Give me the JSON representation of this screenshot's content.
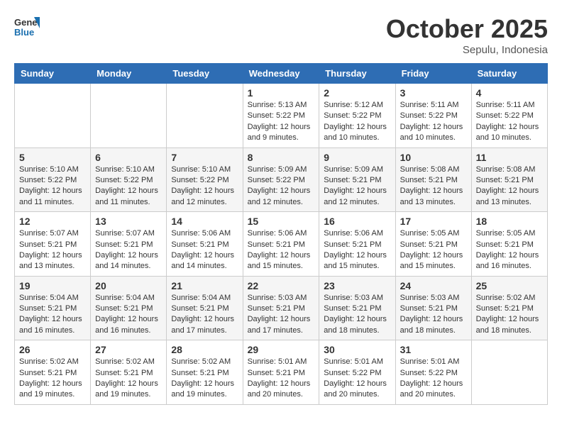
{
  "header": {
    "logo_line1": "General",
    "logo_line2": "Blue",
    "month": "October 2025",
    "location": "Sepulu, Indonesia"
  },
  "weekdays": [
    "Sunday",
    "Monday",
    "Tuesday",
    "Wednesday",
    "Thursday",
    "Friday",
    "Saturday"
  ],
  "weeks": [
    [
      {
        "day": "",
        "sunrise": "",
        "sunset": "",
        "daylight": ""
      },
      {
        "day": "",
        "sunrise": "",
        "sunset": "",
        "daylight": ""
      },
      {
        "day": "",
        "sunrise": "",
        "sunset": "",
        "daylight": ""
      },
      {
        "day": "1",
        "sunrise": "Sunrise: 5:13 AM",
        "sunset": "Sunset: 5:22 PM",
        "daylight": "Daylight: 12 hours and 9 minutes."
      },
      {
        "day": "2",
        "sunrise": "Sunrise: 5:12 AM",
        "sunset": "Sunset: 5:22 PM",
        "daylight": "Daylight: 12 hours and 10 minutes."
      },
      {
        "day": "3",
        "sunrise": "Sunrise: 5:11 AM",
        "sunset": "Sunset: 5:22 PM",
        "daylight": "Daylight: 12 hours and 10 minutes."
      },
      {
        "day": "4",
        "sunrise": "Sunrise: 5:11 AM",
        "sunset": "Sunset: 5:22 PM",
        "daylight": "Daylight: 12 hours and 10 minutes."
      }
    ],
    [
      {
        "day": "5",
        "sunrise": "Sunrise: 5:10 AM",
        "sunset": "Sunset: 5:22 PM",
        "daylight": "Daylight: 12 hours and 11 minutes."
      },
      {
        "day": "6",
        "sunrise": "Sunrise: 5:10 AM",
        "sunset": "Sunset: 5:22 PM",
        "daylight": "Daylight: 12 hours and 11 minutes."
      },
      {
        "day": "7",
        "sunrise": "Sunrise: 5:10 AM",
        "sunset": "Sunset: 5:22 PM",
        "daylight": "Daylight: 12 hours and 12 minutes."
      },
      {
        "day": "8",
        "sunrise": "Sunrise: 5:09 AM",
        "sunset": "Sunset: 5:22 PM",
        "daylight": "Daylight: 12 hours and 12 minutes."
      },
      {
        "day": "9",
        "sunrise": "Sunrise: 5:09 AM",
        "sunset": "Sunset: 5:21 PM",
        "daylight": "Daylight: 12 hours and 12 minutes."
      },
      {
        "day": "10",
        "sunrise": "Sunrise: 5:08 AM",
        "sunset": "Sunset: 5:21 PM",
        "daylight": "Daylight: 12 hours and 13 minutes."
      },
      {
        "day": "11",
        "sunrise": "Sunrise: 5:08 AM",
        "sunset": "Sunset: 5:21 PM",
        "daylight": "Daylight: 12 hours and 13 minutes."
      }
    ],
    [
      {
        "day": "12",
        "sunrise": "Sunrise: 5:07 AM",
        "sunset": "Sunset: 5:21 PM",
        "daylight": "Daylight: 12 hours and 13 minutes."
      },
      {
        "day": "13",
        "sunrise": "Sunrise: 5:07 AM",
        "sunset": "Sunset: 5:21 PM",
        "daylight": "Daylight: 12 hours and 14 minutes."
      },
      {
        "day": "14",
        "sunrise": "Sunrise: 5:06 AM",
        "sunset": "Sunset: 5:21 PM",
        "daylight": "Daylight: 12 hours and 14 minutes."
      },
      {
        "day": "15",
        "sunrise": "Sunrise: 5:06 AM",
        "sunset": "Sunset: 5:21 PM",
        "daylight": "Daylight: 12 hours and 15 minutes."
      },
      {
        "day": "16",
        "sunrise": "Sunrise: 5:06 AM",
        "sunset": "Sunset: 5:21 PM",
        "daylight": "Daylight: 12 hours and 15 minutes."
      },
      {
        "day": "17",
        "sunrise": "Sunrise: 5:05 AM",
        "sunset": "Sunset: 5:21 PM",
        "daylight": "Daylight: 12 hours and 15 minutes."
      },
      {
        "day": "18",
        "sunrise": "Sunrise: 5:05 AM",
        "sunset": "Sunset: 5:21 PM",
        "daylight": "Daylight: 12 hours and 16 minutes."
      }
    ],
    [
      {
        "day": "19",
        "sunrise": "Sunrise: 5:04 AM",
        "sunset": "Sunset: 5:21 PM",
        "daylight": "Daylight: 12 hours and 16 minutes."
      },
      {
        "day": "20",
        "sunrise": "Sunrise: 5:04 AM",
        "sunset": "Sunset: 5:21 PM",
        "daylight": "Daylight: 12 hours and 16 minutes."
      },
      {
        "day": "21",
        "sunrise": "Sunrise: 5:04 AM",
        "sunset": "Sunset: 5:21 PM",
        "daylight": "Daylight: 12 hours and 17 minutes."
      },
      {
        "day": "22",
        "sunrise": "Sunrise: 5:03 AM",
        "sunset": "Sunset: 5:21 PM",
        "daylight": "Daylight: 12 hours and 17 minutes."
      },
      {
        "day": "23",
        "sunrise": "Sunrise: 5:03 AM",
        "sunset": "Sunset: 5:21 PM",
        "daylight": "Daylight: 12 hours and 18 minutes."
      },
      {
        "day": "24",
        "sunrise": "Sunrise: 5:03 AM",
        "sunset": "Sunset: 5:21 PM",
        "daylight": "Daylight: 12 hours and 18 minutes."
      },
      {
        "day": "25",
        "sunrise": "Sunrise: 5:02 AM",
        "sunset": "Sunset: 5:21 PM",
        "daylight": "Daylight: 12 hours and 18 minutes."
      }
    ],
    [
      {
        "day": "26",
        "sunrise": "Sunrise: 5:02 AM",
        "sunset": "Sunset: 5:21 PM",
        "daylight": "Daylight: 12 hours and 19 minutes."
      },
      {
        "day": "27",
        "sunrise": "Sunrise: 5:02 AM",
        "sunset": "Sunset: 5:21 PM",
        "daylight": "Daylight: 12 hours and 19 minutes."
      },
      {
        "day": "28",
        "sunrise": "Sunrise: 5:02 AM",
        "sunset": "Sunset: 5:21 PM",
        "daylight": "Daylight: 12 hours and 19 minutes."
      },
      {
        "day": "29",
        "sunrise": "Sunrise: 5:01 AM",
        "sunset": "Sunset: 5:21 PM",
        "daylight": "Daylight: 12 hours and 20 minutes."
      },
      {
        "day": "30",
        "sunrise": "Sunrise: 5:01 AM",
        "sunset": "Sunset: 5:22 PM",
        "daylight": "Daylight: 12 hours and 20 minutes."
      },
      {
        "day": "31",
        "sunrise": "Sunrise: 5:01 AM",
        "sunset": "Sunset: 5:22 PM",
        "daylight": "Daylight: 12 hours and 20 minutes."
      },
      {
        "day": "",
        "sunrise": "",
        "sunset": "",
        "daylight": ""
      }
    ]
  ]
}
